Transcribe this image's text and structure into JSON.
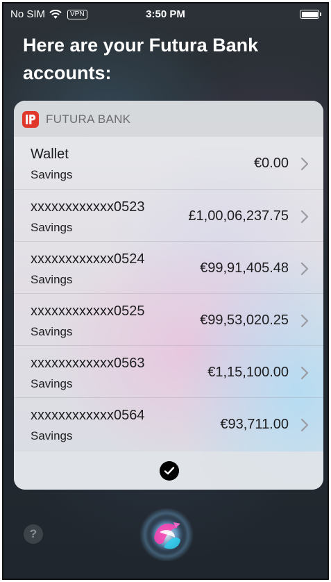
{
  "status_bar": {
    "carrier": "No SIM",
    "vpn": "VPN",
    "time": "3:50 PM"
  },
  "heading": "Here are your Futura Bank accounts:",
  "card": {
    "bank_name": "FUTURA BANK",
    "accounts": [
      {
        "name": "Wallet",
        "type": "Savings",
        "amount": "€0.00"
      },
      {
        "name": "xxxxxxxxxxxx0523",
        "type": "Savings",
        "amount": "£1,00,06,237.75"
      },
      {
        "name": "xxxxxxxxxxxx0524",
        "type": "Savings",
        "amount": "€99,91,405.48"
      },
      {
        "name": "xxxxxxxxxxxx0525",
        "type": "Savings",
        "amount": "€99,53,020.25"
      },
      {
        "name": "xxxxxxxxxxxx0563",
        "type": "Savings",
        "amount": "€1,15,100.00"
      },
      {
        "name": "xxxxxxxxxxxx0564",
        "type": "Savings",
        "amount": "€93,711.00"
      }
    ]
  },
  "help_label": "?",
  "icons": {
    "wifi": "wifi-icon",
    "battery": "battery-icon",
    "chevron": "chevron-right-icon",
    "check": "checkmark-icon",
    "siri": "siri-orb-icon",
    "bank_logo": "futura-bank-logo"
  },
  "colors": {
    "bank_logo": "#e0372b",
    "text_primary": "#1d1d1f",
    "header_text": "#6d6d70"
  }
}
